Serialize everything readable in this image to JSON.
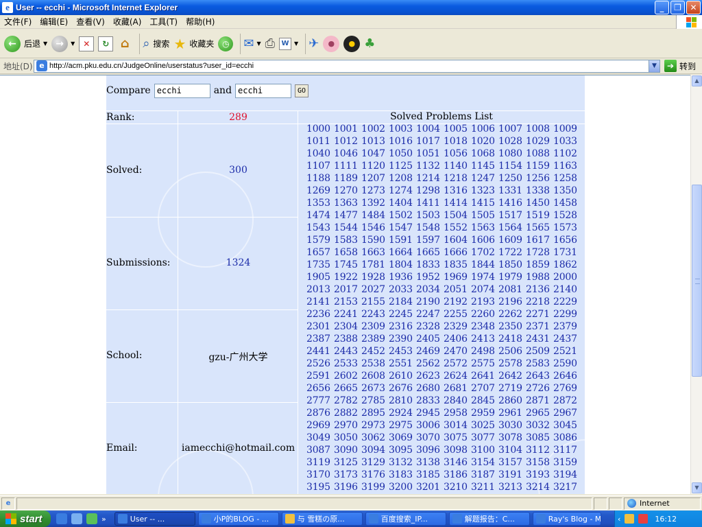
{
  "window": {
    "title": "User -- ecchi - Microsoft Internet Explorer"
  },
  "menu": [
    "文件(F)",
    "编辑(E)",
    "查看(V)",
    "收藏(A)",
    "工具(T)",
    "帮助(H)"
  ],
  "toolbar": {
    "back_label": "后退",
    "search_label": "搜索",
    "favorites_label": "收藏夹"
  },
  "address": {
    "label": "地址(D)",
    "url": "http://acm.pku.edu.cn/JudgeOnline/userstatus?user_id=ecchi",
    "go_label": "转到"
  },
  "page": {
    "compare_label": "Compare",
    "and_label": "and",
    "user1": "ecchi",
    "user2": "ecchi",
    "go_button": "GO",
    "rank_label": "Rank:",
    "rank_value": "289",
    "solved_label": "Solved:",
    "solved_value": "300",
    "submissions_label": "Submissions:",
    "submissions_value": "1324",
    "school_label": "School:",
    "school_value": "gzu-广州大学",
    "email_label": "Email:",
    "email_value": "iamecchi@hotmail.com",
    "list_title": "Solved Problems List",
    "problems": [
      "1000",
      "1001",
      "1002",
      "1003",
      "1004",
      "1005",
      "1006",
      "1007",
      "1008",
      "1009",
      "1011",
      "1012",
      "1013",
      "1016",
      "1017",
      "1018",
      "1020",
      "1028",
      "1029",
      "1033",
      "1040",
      "1046",
      "1047",
      "1050",
      "1051",
      "1056",
      "1068",
      "1080",
      "1088",
      "1102",
      "1107",
      "1111",
      "1120",
      "1125",
      "1132",
      "1140",
      "1145",
      "1154",
      "1159",
      "1163",
      "1188",
      "1189",
      "1207",
      "1208",
      "1214",
      "1218",
      "1247",
      "1250",
      "1256",
      "1258",
      "1269",
      "1270",
      "1273",
      "1274",
      "1298",
      "1316",
      "1323",
      "1331",
      "1338",
      "1350",
      "1353",
      "1363",
      "1392",
      "1404",
      "1411",
      "1414",
      "1415",
      "1416",
      "1450",
      "1458",
      "1474",
      "1477",
      "1484",
      "1502",
      "1503",
      "1504",
      "1505",
      "1517",
      "1519",
      "1528",
      "1543",
      "1544",
      "1546",
      "1547",
      "1548",
      "1552",
      "1563",
      "1564",
      "1565",
      "1573",
      "1579",
      "1583",
      "1590",
      "1591",
      "1597",
      "1604",
      "1606",
      "1609",
      "1617",
      "1656",
      "1657",
      "1658",
      "1663",
      "1664",
      "1665",
      "1666",
      "1702",
      "1722",
      "1728",
      "1731",
      "1735",
      "1745",
      "1781",
      "1804",
      "1833",
      "1835",
      "1844",
      "1850",
      "1859",
      "1862",
      "1905",
      "1922",
      "1928",
      "1936",
      "1952",
      "1969",
      "1974",
      "1979",
      "1988",
      "2000",
      "2013",
      "2017",
      "2027",
      "2033",
      "2034",
      "2051",
      "2074",
      "2081",
      "2136",
      "2140",
      "2141",
      "2153",
      "2155",
      "2184",
      "2190",
      "2192",
      "2193",
      "2196",
      "2218",
      "2229",
      "2236",
      "2241",
      "2243",
      "2245",
      "2247",
      "2255",
      "2260",
      "2262",
      "2271",
      "2299",
      "2301",
      "2304",
      "2309",
      "2316",
      "2328",
      "2329",
      "2348",
      "2350",
      "2371",
      "2379",
      "2387",
      "2388",
      "2389",
      "2390",
      "2405",
      "2406",
      "2413",
      "2418",
      "2431",
      "2437",
      "2441",
      "2443",
      "2452",
      "2453",
      "2469",
      "2470",
      "2498",
      "2506",
      "2509",
      "2521",
      "2526",
      "2533",
      "2538",
      "2551",
      "2562",
      "2572",
      "2575",
      "2578",
      "2583",
      "2590",
      "2591",
      "2602",
      "2608",
      "2610",
      "2623",
      "2624",
      "2641",
      "2642",
      "2643",
      "2646",
      "2656",
      "2665",
      "2673",
      "2676",
      "2680",
      "2681",
      "2707",
      "2719",
      "2726",
      "2769",
      "2777",
      "2782",
      "2785",
      "2810",
      "2833",
      "2840",
      "2845",
      "2860",
      "2871",
      "2872",
      "2876",
      "2882",
      "2895",
      "2924",
      "2945",
      "2958",
      "2959",
      "2961",
      "2965",
      "2967",
      "2969",
      "2970",
      "2973",
      "2975",
      "3006",
      "3014",
      "3025",
      "3030",
      "3032",
      "3045",
      "3049",
      "3050",
      "3062",
      "3069",
      "3070",
      "3075",
      "3077",
      "3078",
      "3085",
      "3086",
      "3087",
      "3090",
      "3094",
      "3095",
      "3096",
      "3098",
      "3100",
      "3104",
      "3112",
      "3117",
      "3119",
      "3125",
      "3129",
      "3132",
      "3138",
      "3146",
      "3154",
      "3157",
      "3158",
      "3159",
      "3170",
      "3173",
      "3176",
      "3183",
      "3185",
      "3186",
      "3187",
      "3191",
      "3193",
      "3194",
      "3195",
      "3196",
      "3199",
      "3200",
      "3201",
      "3210",
      "3211",
      "3213",
      "3214",
      "3217"
    ]
  },
  "status": {
    "zone": "Internet"
  },
  "taskbar": {
    "start_label": "start",
    "tasks": [
      "User -- ...",
      "小P的BLOG - ...",
      "与 雪糕の原...",
      "百度搜索_IP...",
      "解题报告：C...",
      "Ray's Blog - Mi..."
    ],
    "clock": "16:12"
  },
  "colors": {
    "page_bg": "#d9e5fb",
    "rank_color": "#e0102a",
    "link_color": "#1a2aa8",
    "titlebar": "#0a5be0"
  }
}
